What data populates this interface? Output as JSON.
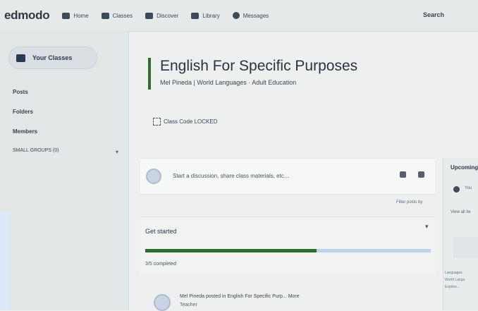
{
  "topbar": {
    "logo": "edmodo",
    "nav": [
      {
        "label": "Home",
        "icon": "home-icon"
      },
      {
        "label": "Classes",
        "icon": "classes-icon"
      },
      {
        "label": "Discover",
        "icon": "discover-icon"
      },
      {
        "label": "Library",
        "icon": "library-icon"
      },
      {
        "label": "Messages",
        "icon": "messages-icon"
      }
    ],
    "search_label": "Search"
  },
  "sidebar": {
    "classes_button": "Your Classes",
    "links": [
      "Posts",
      "Folders",
      "Members",
      "SMALL GROUPS (0)"
    ]
  },
  "class": {
    "title": "English For Specific Purposes",
    "subtitle": "Mel Pineda | World Languages · Adult Education",
    "class_code": "Class Code LOCKED"
  },
  "composer": {
    "placeholder": "Start a discussion, share class materials, etc..."
  },
  "feed": {
    "filter_label": "Filter posts by"
  },
  "get_started": {
    "title": "Get started",
    "progress": 0.6,
    "completed_text": "3/5 completed"
  },
  "post": {
    "text": "Mel Pineda posted in English For Specific Purp... More",
    "author_role": "Teacher"
  },
  "right_panel": {
    "title": "Upcoming",
    "item": "You",
    "view_all": "View all ite",
    "notes": [
      "Languages",
      "World Langu",
      "Explore..."
    ]
  },
  "colors": {
    "accent_green": "#2d6e2d",
    "progress_track": "#bcd3ec",
    "nav_dark": "#2f3a45"
  }
}
